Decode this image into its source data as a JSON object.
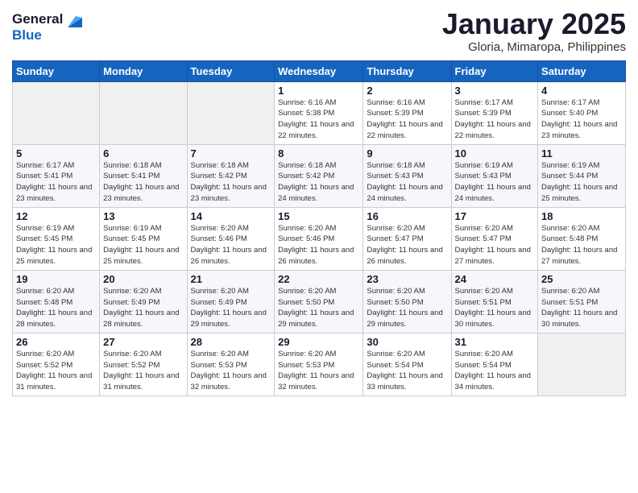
{
  "header": {
    "title": "January 2025",
    "subtitle": "Gloria, Mimaropa, Philippines"
  },
  "weekdays": [
    "Sunday",
    "Monday",
    "Tuesday",
    "Wednesday",
    "Thursday",
    "Friday",
    "Saturday"
  ],
  "weeks": [
    [
      {
        "day": "",
        "sunrise": "",
        "sunset": "",
        "daylight": ""
      },
      {
        "day": "",
        "sunrise": "",
        "sunset": "",
        "daylight": ""
      },
      {
        "day": "",
        "sunrise": "",
        "sunset": "",
        "daylight": ""
      },
      {
        "day": "1",
        "sunrise": "Sunrise: 6:16 AM",
        "sunset": "Sunset: 5:38 PM",
        "daylight": "Daylight: 11 hours and 22 minutes."
      },
      {
        "day": "2",
        "sunrise": "Sunrise: 6:16 AM",
        "sunset": "Sunset: 5:39 PM",
        "daylight": "Daylight: 11 hours and 22 minutes."
      },
      {
        "day": "3",
        "sunrise": "Sunrise: 6:17 AM",
        "sunset": "Sunset: 5:39 PM",
        "daylight": "Daylight: 11 hours and 22 minutes."
      },
      {
        "day": "4",
        "sunrise": "Sunrise: 6:17 AM",
        "sunset": "Sunset: 5:40 PM",
        "daylight": "Daylight: 11 hours and 23 minutes."
      }
    ],
    [
      {
        "day": "5",
        "sunrise": "Sunrise: 6:17 AM",
        "sunset": "Sunset: 5:41 PM",
        "daylight": "Daylight: 11 hours and 23 minutes."
      },
      {
        "day": "6",
        "sunrise": "Sunrise: 6:18 AM",
        "sunset": "Sunset: 5:41 PM",
        "daylight": "Daylight: 11 hours and 23 minutes."
      },
      {
        "day": "7",
        "sunrise": "Sunrise: 6:18 AM",
        "sunset": "Sunset: 5:42 PM",
        "daylight": "Daylight: 11 hours and 23 minutes."
      },
      {
        "day": "8",
        "sunrise": "Sunrise: 6:18 AM",
        "sunset": "Sunset: 5:42 PM",
        "daylight": "Daylight: 11 hours and 24 minutes."
      },
      {
        "day": "9",
        "sunrise": "Sunrise: 6:18 AM",
        "sunset": "Sunset: 5:43 PM",
        "daylight": "Daylight: 11 hours and 24 minutes."
      },
      {
        "day": "10",
        "sunrise": "Sunrise: 6:19 AM",
        "sunset": "Sunset: 5:43 PM",
        "daylight": "Daylight: 11 hours and 24 minutes."
      },
      {
        "day": "11",
        "sunrise": "Sunrise: 6:19 AM",
        "sunset": "Sunset: 5:44 PM",
        "daylight": "Daylight: 11 hours and 25 minutes."
      }
    ],
    [
      {
        "day": "12",
        "sunrise": "Sunrise: 6:19 AM",
        "sunset": "Sunset: 5:45 PM",
        "daylight": "Daylight: 11 hours and 25 minutes."
      },
      {
        "day": "13",
        "sunrise": "Sunrise: 6:19 AM",
        "sunset": "Sunset: 5:45 PM",
        "daylight": "Daylight: 11 hours and 25 minutes."
      },
      {
        "day": "14",
        "sunrise": "Sunrise: 6:20 AM",
        "sunset": "Sunset: 5:46 PM",
        "daylight": "Daylight: 11 hours and 26 minutes."
      },
      {
        "day": "15",
        "sunrise": "Sunrise: 6:20 AM",
        "sunset": "Sunset: 5:46 PM",
        "daylight": "Daylight: 11 hours and 26 minutes."
      },
      {
        "day": "16",
        "sunrise": "Sunrise: 6:20 AM",
        "sunset": "Sunset: 5:47 PM",
        "daylight": "Daylight: 11 hours and 26 minutes."
      },
      {
        "day": "17",
        "sunrise": "Sunrise: 6:20 AM",
        "sunset": "Sunset: 5:47 PM",
        "daylight": "Daylight: 11 hours and 27 minutes."
      },
      {
        "day": "18",
        "sunrise": "Sunrise: 6:20 AM",
        "sunset": "Sunset: 5:48 PM",
        "daylight": "Daylight: 11 hours and 27 minutes."
      }
    ],
    [
      {
        "day": "19",
        "sunrise": "Sunrise: 6:20 AM",
        "sunset": "Sunset: 5:48 PM",
        "daylight": "Daylight: 11 hours and 28 minutes."
      },
      {
        "day": "20",
        "sunrise": "Sunrise: 6:20 AM",
        "sunset": "Sunset: 5:49 PM",
        "daylight": "Daylight: 11 hours and 28 minutes."
      },
      {
        "day": "21",
        "sunrise": "Sunrise: 6:20 AM",
        "sunset": "Sunset: 5:49 PM",
        "daylight": "Daylight: 11 hours and 29 minutes."
      },
      {
        "day": "22",
        "sunrise": "Sunrise: 6:20 AM",
        "sunset": "Sunset: 5:50 PM",
        "daylight": "Daylight: 11 hours and 29 minutes."
      },
      {
        "day": "23",
        "sunrise": "Sunrise: 6:20 AM",
        "sunset": "Sunset: 5:50 PM",
        "daylight": "Daylight: 11 hours and 29 minutes."
      },
      {
        "day": "24",
        "sunrise": "Sunrise: 6:20 AM",
        "sunset": "Sunset: 5:51 PM",
        "daylight": "Daylight: 11 hours and 30 minutes."
      },
      {
        "day": "25",
        "sunrise": "Sunrise: 6:20 AM",
        "sunset": "Sunset: 5:51 PM",
        "daylight": "Daylight: 11 hours and 30 minutes."
      }
    ],
    [
      {
        "day": "26",
        "sunrise": "Sunrise: 6:20 AM",
        "sunset": "Sunset: 5:52 PM",
        "daylight": "Daylight: 11 hours and 31 minutes."
      },
      {
        "day": "27",
        "sunrise": "Sunrise: 6:20 AM",
        "sunset": "Sunset: 5:52 PM",
        "daylight": "Daylight: 11 hours and 31 minutes."
      },
      {
        "day": "28",
        "sunrise": "Sunrise: 6:20 AM",
        "sunset": "Sunset: 5:53 PM",
        "daylight": "Daylight: 11 hours and 32 minutes."
      },
      {
        "day": "29",
        "sunrise": "Sunrise: 6:20 AM",
        "sunset": "Sunset: 5:53 PM",
        "daylight": "Daylight: 11 hours and 32 minutes."
      },
      {
        "day": "30",
        "sunrise": "Sunrise: 6:20 AM",
        "sunset": "Sunset: 5:54 PM",
        "daylight": "Daylight: 11 hours and 33 minutes."
      },
      {
        "day": "31",
        "sunrise": "Sunrise: 6:20 AM",
        "sunset": "Sunset: 5:54 PM",
        "daylight": "Daylight: 11 hours and 34 minutes."
      },
      {
        "day": "",
        "sunrise": "",
        "sunset": "",
        "daylight": ""
      }
    ]
  ]
}
